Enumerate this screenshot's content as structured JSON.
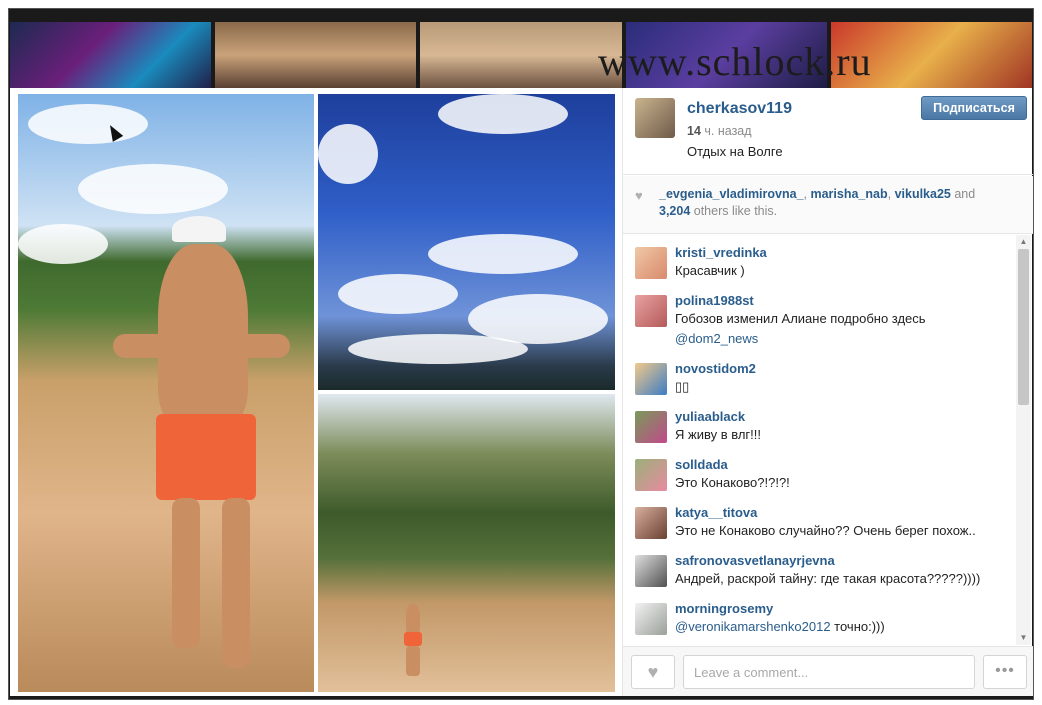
{
  "watermark": "www.schlock.ru",
  "post": {
    "username": "cherkasov119",
    "time_value": "14",
    "time_unit": "ч. назад",
    "caption": "Отдых на Волге",
    "follow_label": "Подписаться",
    "avatar_icon": "user-avatar"
  },
  "likes": {
    "user1": "_evgenia_vladimirovna_",
    "sep1": ", ",
    "user2": "marisha_nab",
    "sep2": ", ",
    "user3": "vikulka25",
    "and": " and",
    "count": "3,204",
    "others": " others like this.",
    "icon": "heart-icon"
  },
  "comments": [
    {
      "user": "kristi_vredinka",
      "text": "Красавчик )"
    },
    {
      "user": "polina1988st",
      "text": "Гобозов изменил Алиане подробно здесь",
      "tags": "@dom2_news"
    },
    {
      "user": "novostidom2",
      "text": "▯▯"
    },
    {
      "user": "yuliaablack",
      "text": "Я живу в влг!!!"
    },
    {
      "user": "solldada",
      "text": "Это Конаково?!?!?!"
    },
    {
      "user": "katya__titova",
      "text": "Это не Конаково случайно?? Очень берег похож.."
    },
    {
      "user": "safronovasvetlanayrjevna",
      "text": "Андрей, раскрой тайну: где такая красота?????))))"
    },
    {
      "user": "morningrosemy",
      "mention": "@veronikamarshenko2012",
      "text": " точно:)))"
    }
  ],
  "footer": {
    "comment_placeholder": "Leave a comment...",
    "more_label": "•••",
    "like_icon": "heart-icon"
  },
  "colors": {
    "link": "#2a5d8c",
    "follow_button": "#4a77a4"
  }
}
